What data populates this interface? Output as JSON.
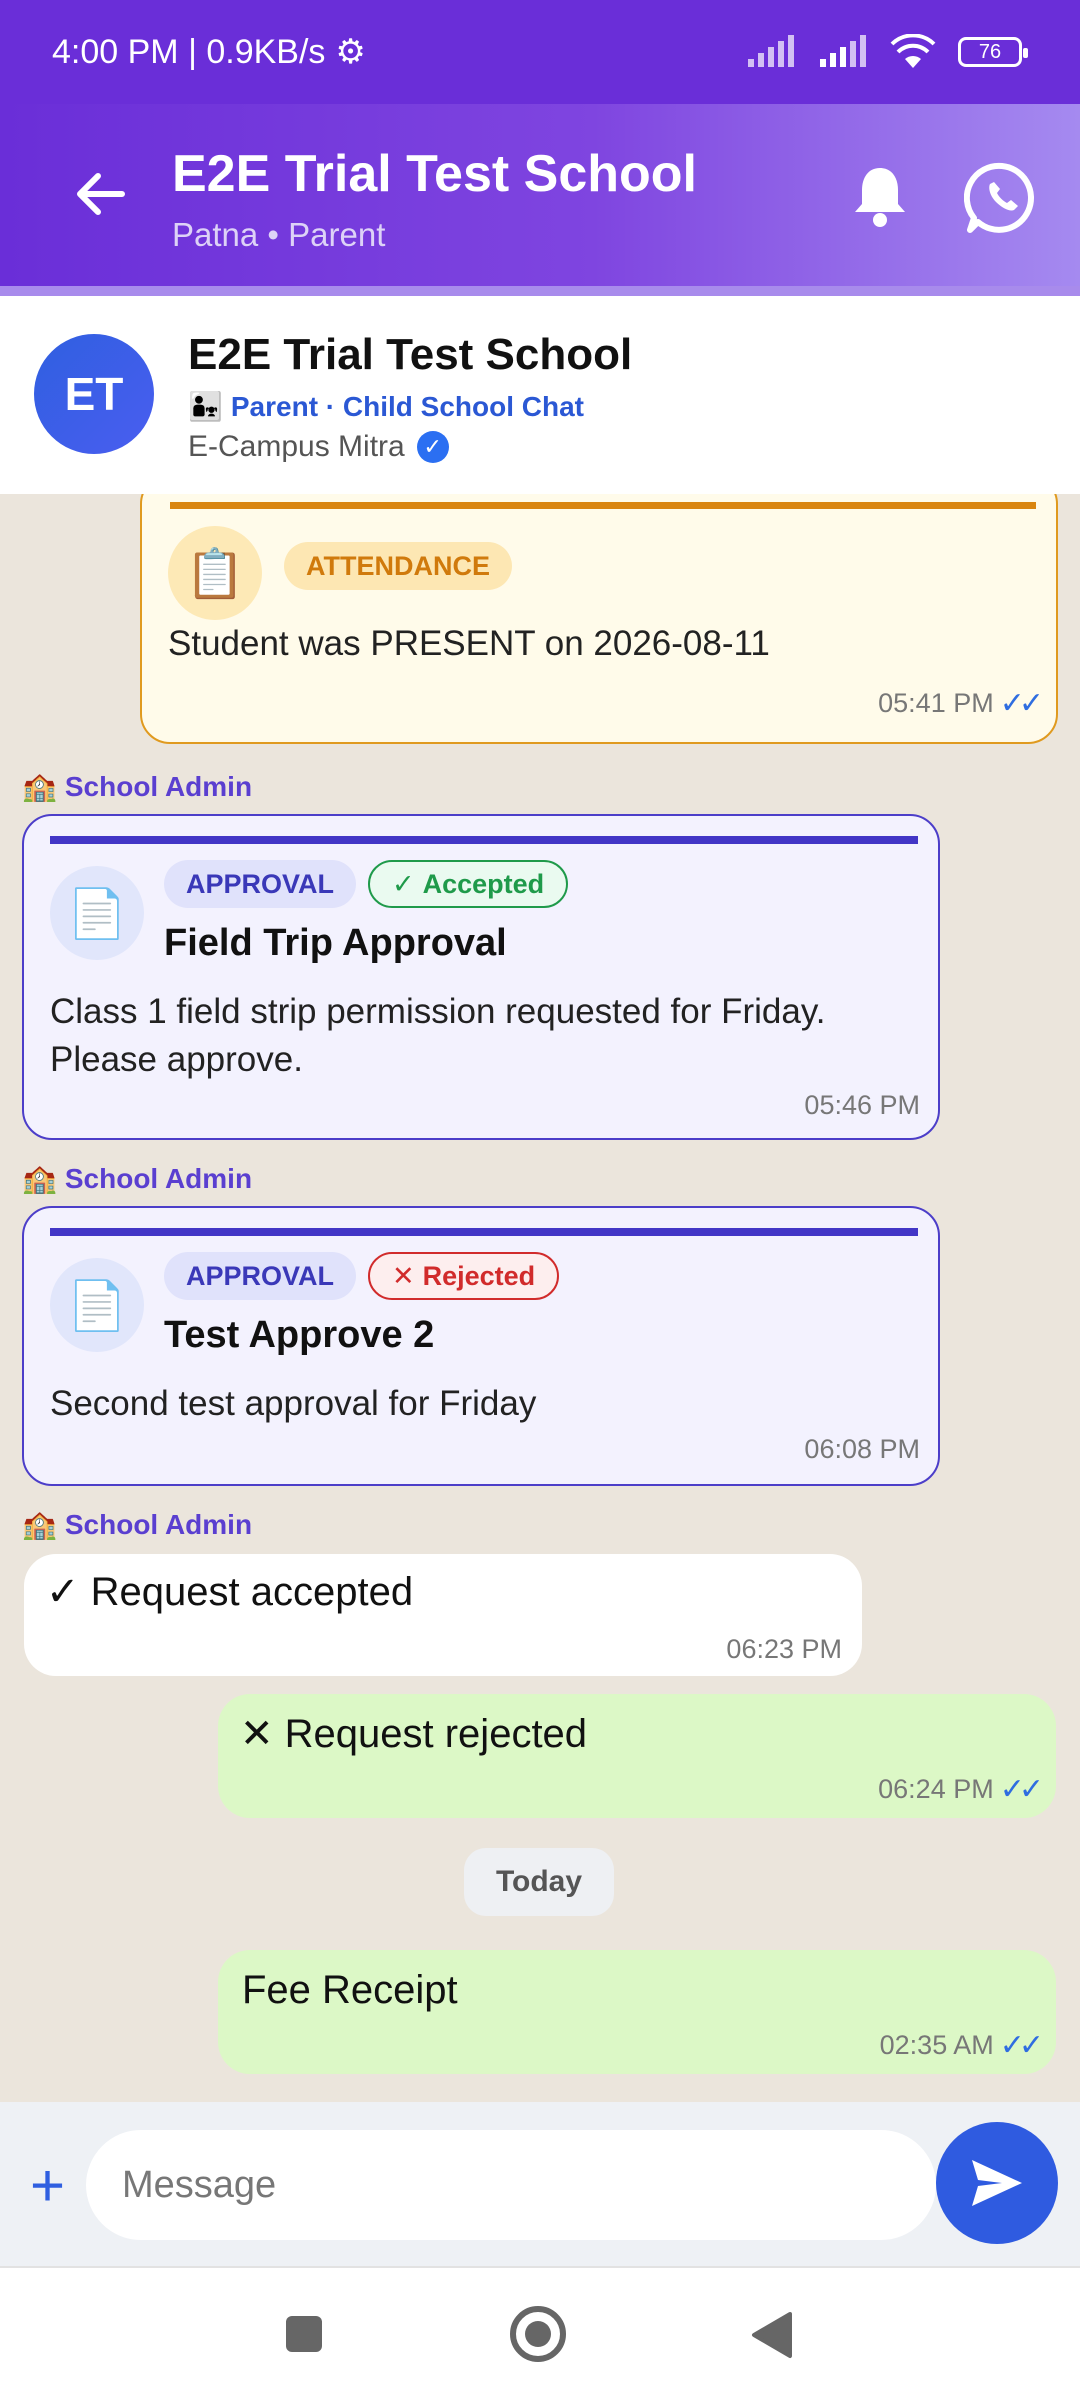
{
  "status_bar": {
    "time_speed": "4:00 PM | 0.9KB/s",
    "battery": "76"
  },
  "appbar": {
    "title": "E2E Trial Test School",
    "subtitle": "Patna • Parent"
  },
  "chat_header": {
    "avatar_initials": "ET",
    "title": "E2E Trial Test School",
    "subtitle": "Parent · Child School Chat",
    "verified_name": "E-Campus Mitra"
  },
  "messages": {
    "attendance": {
      "tag": "ATTENDANCE",
      "text": "Student was PRESENT on 2026-08-11",
      "time": "05:41 PM"
    },
    "sender_label": "School Admin",
    "approval1": {
      "tag": "APPROVAL",
      "status": "Accepted",
      "title": "Field Trip Approval",
      "text_line1": "Class 1 field strip permission requested for Friday.",
      "text_line2": "Please approve.",
      "time": "05:46 PM"
    },
    "approval2": {
      "tag": "APPROVAL",
      "status": "Rejected",
      "title": "Test Approve 2",
      "text": "Second test approval for Friday",
      "time": "06:08 PM"
    },
    "incoming": {
      "text": "Request accepted",
      "time": "06:23 PM"
    },
    "outgoing1": {
      "text": "Request rejected",
      "time": "06:24 PM"
    },
    "date_divider": "Today",
    "outgoing2": {
      "text": "Fee Receipt",
      "time": "02:35 AM"
    }
  },
  "composer": {
    "placeholder": "Message"
  },
  "colors": {
    "primary": "#6a2ed8",
    "accent_blue": "#2f5be0",
    "attendance_orange": "#d98510",
    "approval_indigo": "#4236c6",
    "accepted_green": "#1f9a4a",
    "rejected_red": "#d12b2b",
    "outgoing_bubble": "#dcf8c6"
  }
}
